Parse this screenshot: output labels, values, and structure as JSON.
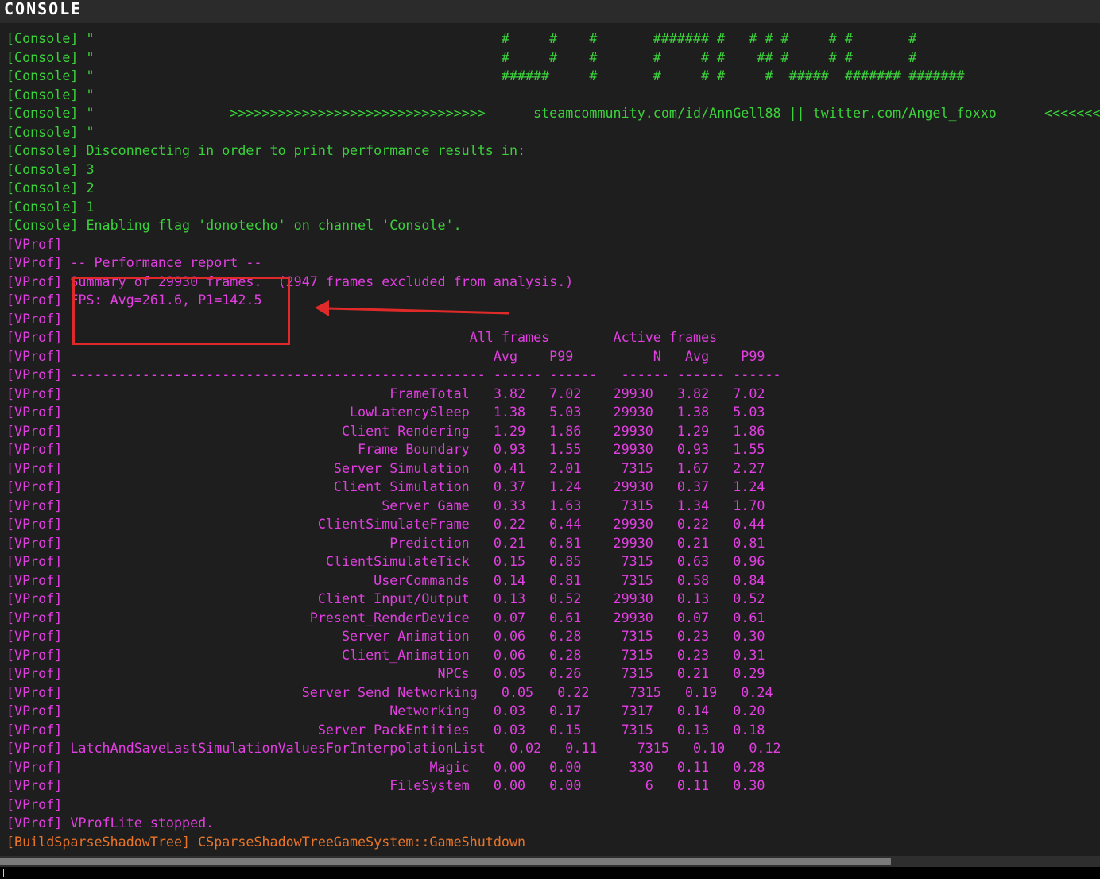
{
  "window": {
    "title": "CONSOLE"
  },
  "log_lines": [
    {
      "color": "green",
      "text": "[Console] \"                                                   #     #    #       ####### #   # # #     # #       #"
    },
    {
      "color": "green",
      "text": "[Console] \"                                                   #     #    #       #     # #    ## #     # #       #"
    },
    {
      "color": "green",
      "text": "[Console] \"                                                   ######     #       #     # #     #  #####  ####### #######"
    },
    {
      "color": "green",
      "text": "[Console] \""
    },
    {
      "color": "green",
      "text": "[Console] \"                 >>>>>>>>>>>>>>>>>>>>>>>>>>>>>>>>      steamcommunity.com/id/AnnGell88 || twitter.com/Angel_foxxo      <<<<<<<<"
    },
    {
      "color": "green",
      "text": "[Console] \""
    },
    {
      "color": "green",
      "text": "[Console] Disconnecting in order to print performance results in:"
    },
    {
      "color": "green",
      "text": "[Console] 3"
    },
    {
      "color": "green",
      "text": "[Console] 2"
    },
    {
      "color": "green",
      "text": "[Console] 1"
    },
    {
      "color": "green",
      "text": "[Console] Enabling flag 'donotecho' on channel 'Console'."
    },
    {
      "color": "magenta",
      "text": "[VProf]"
    },
    {
      "color": "magenta",
      "text": "[VProf] -- Performance report --"
    },
    {
      "color": "magenta",
      "text": "[VProf] Summary of 29930 frames.  (2947 frames excluded from analysis.)"
    },
    {
      "color": "magenta",
      "text": "[VProf] FPS: Avg=261.6, P1=142.5"
    },
    {
      "color": "magenta",
      "text": "[VProf]"
    },
    {
      "color": "magenta",
      "text": "[VProf]                                                   All frames        Active frames"
    },
    {
      "color": "magenta",
      "text": "[VProf]                                                      Avg    P99          N   Avg    P99"
    },
    {
      "color": "magenta",
      "text": "[VProf] ---------------------------------------------------- ------ ------   ------ ------ ------"
    },
    {
      "color": "magenta",
      "text": "[VProf]                                         FrameTotal   3.82   7.02    29930   3.82   7.02"
    },
    {
      "color": "magenta",
      "text": "[VProf]                                    LowLatencySleep   1.38   5.03    29930   1.38   5.03"
    },
    {
      "color": "magenta",
      "text": "[VProf]                                   Client Rendering   1.29   1.86    29930   1.29   1.86"
    },
    {
      "color": "magenta",
      "text": "[VProf]                                     Frame Boundary   0.93   1.55    29930   0.93   1.55"
    },
    {
      "color": "magenta",
      "text": "[VProf]                                  Server Simulation   0.41   2.01     7315   1.67   2.27"
    },
    {
      "color": "magenta",
      "text": "[VProf]                                  Client Simulation   0.37   1.24    29930   0.37   1.24"
    },
    {
      "color": "magenta",
      "text": "[VProf]                                        Server Game   0.33   1.63     7315   1.34   1.70"
    },
    {
      "color": "magenta",
      "text": "[VProf]                                ClientSimulateFrame   0.22   0.44    29930   0.22   0.44"
    },
    {
      "color": "magenta",
      "text": "[VProf]                                         Prediction   0.21   0.81    29930   0.21   0.81"
    },
    {
      "color": "magenta",
      "text": "[VProf]                                 ClientSimulateTick   0.15   0.85     7315   0.63   0.96"
    },
    {
      "color": "magenta",
      "text": "[VProf]                                       UserCommands   0.14   0.81     7315   0.58   0.84"
    },
    {
      "color": "magenta",
      "text": "[VProf]                                Client Input/Output   0.13   0.52    29930   0.13   0.52"
    },
    {
      "color": "magenta",
      "text": "[VProf]                               Present_RenderDevice   0.07   0.61    29930   0.07   0.61"
    },
    {
      "color": "magenta",
      "text": "[VProf]                                   Server Animation   0.06   0.28     7315   0.23   0.30"
    },
    {
      "color": "magenta",
      "text": "[VProf]                                   Client_Animation   0.06   0.28     7315   0.23   0.31"
    },
    {
      "color": "magenta",
      "text": "[VProf]                                               NPCs   0.05   0.26     7315   0.21   0.29"
    },
    {
      "color": "magenta",
      "text": "[VProf]                              Server Send Networking   0.05   0.22     7315   0.19   0.24"
    },
    {
      "color": "magenta",
      "text": "[VProf]                                         Networking   0.03   0.17     7317   0.14   0.20"
    },
    {
      "color": "magenta",
      "text": "[VProf]                                Server PackEntities   0.03   0.15     7315   0.13   0.18"
    },
    {
      "color": "magenta",
      "text": "[VProf] LatchAndSaveLastSimulationValuesForInterpolationList   0.02   0.11     7315   0.10   0.12"
    },
    {
      "color": "magenta",
      "text": "[VProf]                                              Magic   0.00   0.00      330   0.11   0.28"
    },
    {
      "color": "magenta",
      "text": "[VProf]                                         FileSystem   0.00   0.00        6   0.11   0.30"
    },
    {
      "color": "magenta",
      "text": "[VProf]"
    },
    {
      "color": "magenta",
      "text": "[VProf] VProfLite stopped."
    },
    {
      "color": "orange",
      "text": "[BuildSparseShadowTree] CSparseShadowTreeGameSystem::GameShutdown"
    }
  ],
  "colors": {
    "background": "#1e1e1e",
    "green": "#3ad23a",
    "magenta": "#e23ee2",
    "orange": "#e8752a",
    "annotation_red": "#e02a2a"
  },
  "annotation": {
    "icon": "arrow-icon"
  },
  "scrollbar": {
    "horizontal_position": 0.81
  }
}
